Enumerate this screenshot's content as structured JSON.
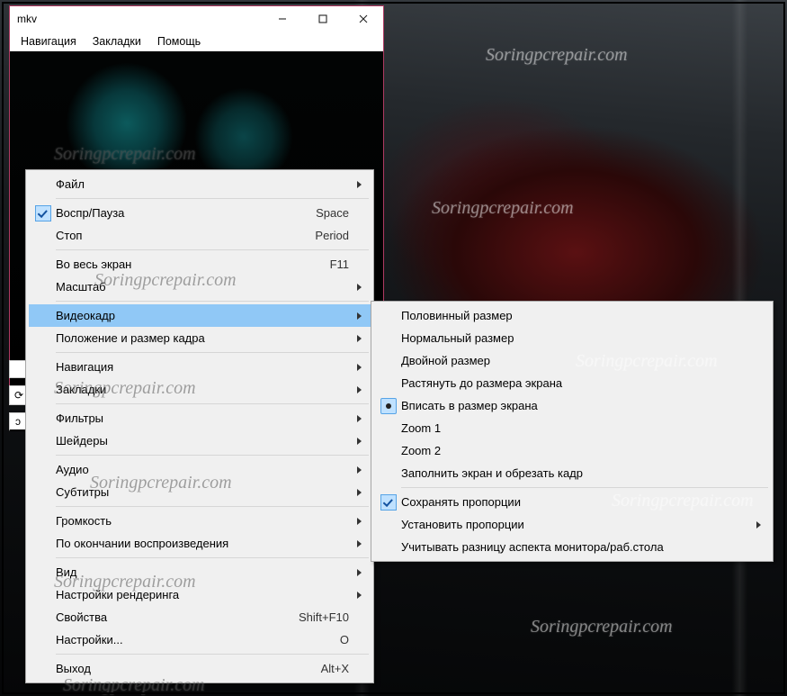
{
  "watermark_text": "Soringpcrepair.com",
  "window": {
    "title": "mkv",
    "menubar": [
      "Навигация",
      "Закладки",
      "Помощь"
    ]
  },
  "side_widgets": {
    "b": "⟳",
    "c": "ɔ"
  },
  "context_menu": [
    {
      "type": "item",
      "label": "Файл",
      "submenu": true
    },
    {
      "type": "sep"
    },
    {
      "type": "item",
      "label": "Воспр/Пауза",
      "accel": "Space",
      "checked": true
    },
    {
      "type": "item",
      "label": "Стоп",
      "accel": "Period"
    },
    {
      "type": "sep"
    },
    {
      "type": "item",
      "label": "Во весь экран",
      "accel": "F11"
    },
    {
      "type": "item",
      "label": "Масштаб",
      "submenu": true
    },
    {
      "type": "sep"
    },
    {
      "type": "item",
      "label": "Видеокадр",
      "submenu": true,
      "highlight": true
    },
    {
      "type": "item",
      "label": "Положение и размер кадра",
      "submenu": true
    },
    {
      "type": "sep"
    },
    {
      "type": "item",
      "label": "Навигация",
      "submenu": true
    },
    {
      "type": "item",
      "label": "Закладки",
      "submenu": true
    },
    {
      "type": "sep"
    },
    {
      "type": "item",
      "label": "Фильтры",
      "submenu": true
    },
    {
      "type": "item",
      "label": "Шейдеры",
      "submenu": true
    },
    {
      "type": "sep"
    },
    {
      "type": "item",
      "label": "Аудио",
      "submenu": true
    },
    {
      "type": "item",
      "label": "Субтитры",
      "submenu": true
    },
    {
      "type": "sep"
    },
    {
      "type": "item",
      "label": "Громкость",
      "submenu": true
    },
    {
      "type": "item",
      "label": "По окончании воспроизведения",
      "submenu": true
    },
    {
      "type": "sep"
    },
    {
      "type": "item",
      "label": "Вид",
      "submenu": true
    },
    {
      "type": "item",
      "label": "Настройки рендеринга",
      "submenu": true
    },
    {
      "type": "item",
      "label": "Свойства",
      "accel": "Shift+F10"
    },
    {
      "type": "item",
      "label": "Настройки...",
      "accel": "O"
    },
    {
      "type": "sep"
    },
    {
      "type": "item",
      "label": "Выход",
      "accel": "Alt+X"
    }
  ],
  "submenu": [
    {
      "type": "item",
      "label": "Половинный размер"
    },
    {
      "type": "item",
      "label": "Нормальный размер"
    },
    {
      "type": "item",
      "label": "Двойной размер"
    },
    {
      "type": "item",
      "label": "Растянуть до размера экрана"
    },
    {
      "type": "item",
      "label": "Вписать в размер экрана",
      "radio": true
    },
    {
      "type": "item",
      "label": "Zoom 1"
    },
    {
      "type": "item",
      "label": "Zoom 2"
    },
    {
      "type": "item",
      "label": "Заполнить экран и обрезать кадр"
    },
    {
      "type": "sep"
    },
    {
      "type": "item",
      "label": "Сохранять пропорции",
      "checked": true
    },
    {
      "type": "item",
      "label": "Установить пропорции",
      "submenu": true
    },
    {
      "type": "item",
      "label": "Учитывать разницу аспекта монитора/раб.стола"
    }
  ]
}
